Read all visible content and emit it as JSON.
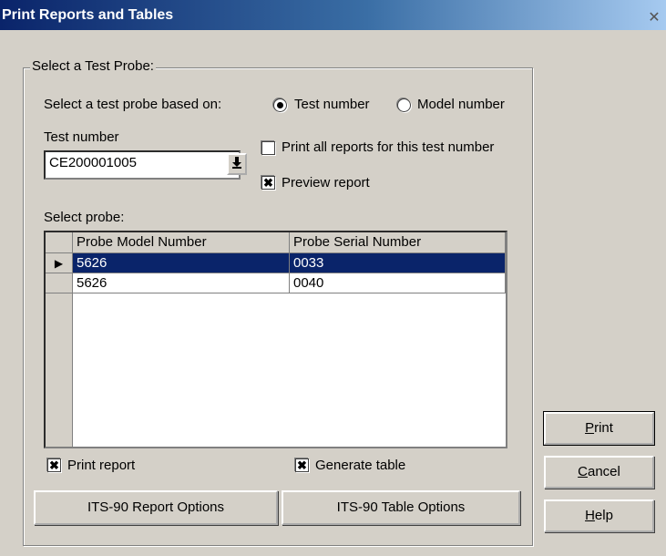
{
  "window": {
    "title": "Print Reports and Tables",
    "close_glyph": "✕"
  },
  "group": {
    "label": "Select a Test Probe:",
    "based_on_label": "Select a test probe based on:",
    "radio_test_number": "Test number",
    "radio_model_number": "Model number",
    "selected_radio": "test_number",
    "test_number_label": "Test number",
    "test_number_value": "CE200001005",
    "print_all_label": "Print all reports for this test number",
    "print_all_checked": false,
    "preview_label": "Preview report",
    "preview_checked": true,
    "select_probe_label": "Select probe:"
  },
  "table": {
    "columns": [
      "Probe Model Number",
      "Probe Serial Number"
    ],
    "rows": [
      {
        "model": "5626",
        "serial": "0033",
        "selected": true
      },
      {
        "model": "5626",
        "serial": "0040",
        "selected": false
      }
    ],
    "row_marker_glyph": "▶"
  },
  "options": {
    "print_report_label": "Print report",
    "print_report_checked": true,
    "generate_table_label": "Generate table",
    "generate_table_checked": true,
    "report_options_button": "ITS-90 Report Options",
    "table_options_button": "ITS-90 Table Options"
  },
  "buttons": {
    "print_prefix": "P",
    "print_rest": "rint",
    "cancel_prefix": "C",
    "cancel_rest": "ancel",
    "help_prefix": "H",
    "help_rest": "elp"
  },
  "icons": {
    "dropdown": "download-arrow-icon",
    "check_mark": "✖"
  },
  "colors": {
    "title_bar": "#0a246a",
    "selection": "#0a246a",
    "face": "#d4d0c8"
  }
}
